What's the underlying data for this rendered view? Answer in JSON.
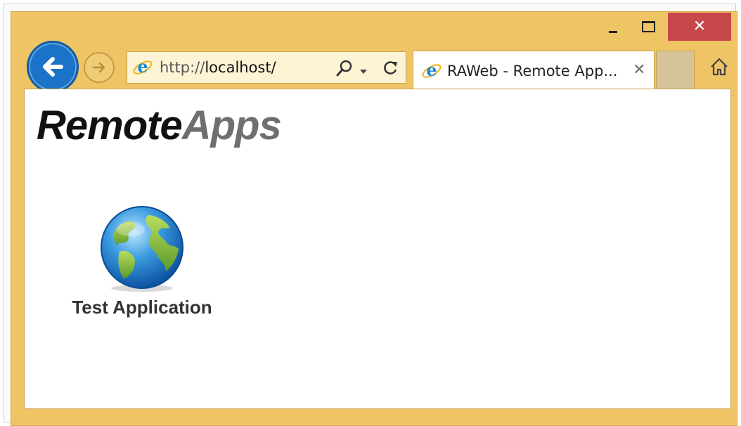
{
  "browser": {
    "address_url_prefix": "http://",
    "address_url_host": "localhost/",
    "tab_title": "RAWeb - Remote App...",
    "tab_close_glyph": "✕",
    "close_glyph": "✕",
    "icons": {
      "back": "back-arrow-icon",
      "forward": "forward-arrow-icon",
      "ie": "internet-explorer-icon",
      "search": "search-icon",
      "dropdown": "chevron-down-icon",
      "refresh": "refresh-icon",
      "home": "home-icon"
    }
  },
  "page": {
    "heading_part1": "Remote",
    "heading_part2": "Apps",
    "apps": [
      {
        "label": "Test Application",
        "icon": "globe-icon"
      }
    ]
  },
  "colors": {
    "window_frame": "#efc465",
    "close_button": "#c8474b",
    "back_button": "#1a73c8",
    "heading_primary": "#111111",
    "heading_secondary": "#6f6f6f"
  }
}
